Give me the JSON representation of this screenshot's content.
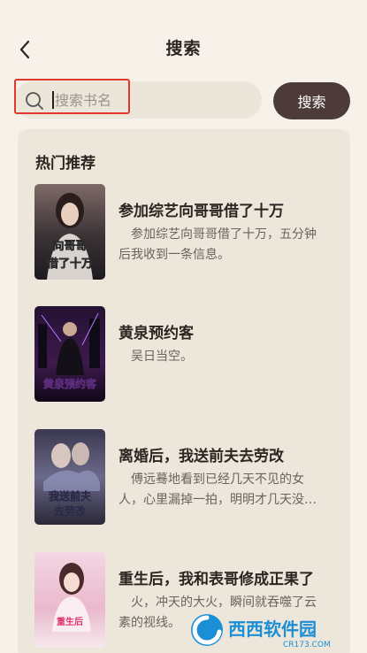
{
  "header": {
    "title": "搜索"
  },
  "search": {
    "placeholder": "搜索书名",
    "value": "",
    "button_label": "搜索"
  },
  "recommend": {
    "title": "热门推荐",
    "books": [
      {
        "title": "参加综艺向哥哥借了十万",
        "desc": "参加综艺向哥哥借了十万，五分钟后我收到一条信息。",
        "cover_text": "向哥哥借了十万"
      },
      {
        "title": "黄泉预约客",
        "desc": "吴日当空。",
        "cover_text": "黄泉预约客"
      },
      {
        "title": "离婚后，我送前夫去劳改",
        "desc": "傅远蓦地看到已经几天不见的女人，心里漏掉一拍，明明才几天没见，",
        "cover_text": "我送前夫去劳改"
      },
      {
        "title": "重生后，我和表哥修成正果了",
        "desc": "火，冲天的大火，瞬间就吞噬了云素的视线。",
        "cover_text": "重生后"
      }
    ]
  },
  "watermark": {
    "text": "西西软件园",
    "sub": "CR173.COM"
  },
  "colors": {
    "accent": "#4d3b39",
    "background": "#f6f2ea",
    "panel": "#ede6db",
    "highlight": "#e0392b"
  }
}
